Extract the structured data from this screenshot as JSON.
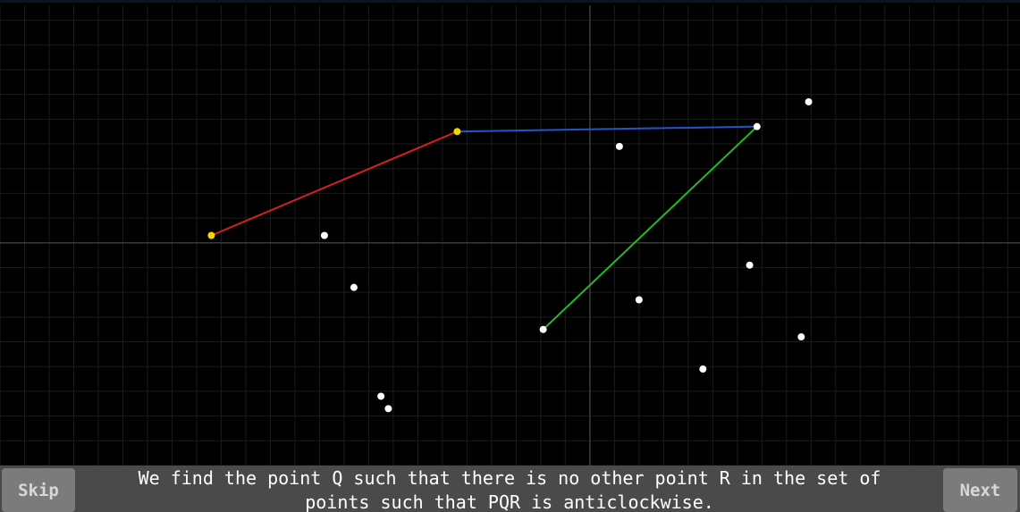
{
  "controls": {
    "skip_label": "Skip",
    "next_label": "Next"
  },
  "caption": {
    "text": "We find the point Q such that there is no other point R in the set of\npoints such that PQR is anticlockwise."
  },
  "colors": {
    "background": "#000000",
    "grid_minor": "#1c1c1c",
    "axis": "#3a3a3a",
    "point": "#ffffff",
    "hull_point": "#f2d600",
    "edge_hull": "#d42020",
    "edge_candidate": "#2255cc",
    "edge_test": "#22bb22",
    "bottom_bar": "#4a4a4a",
    "button": "#7b7b7b"
  },
  "scene": {
    "points": [
      {
        "x": -7.7,
        "y": 0.15,
        "hull": true
      },
      {
        "x": -2.7,
        "y": 2.25,
        "hull": true
      },
      {
        "x": 3.4,
        "y": 2.35,
        "hull": false
      },
      {
        "x": 4.45,
        "y": 2.85,
        "hull": false
      },
      {
        "x": 0.6,
        "y": 1.95,
        "hull": false
      },
      {
        "x": -5.4,
        "y": 0.15,
        "hull": false
      },
      {
        "x": -4.8,
        "y": -0.9,
        "hull": false
      },
      {
        "x": -0.95,
        "y": -1.75,
        "hull": false
      },
      {
        "x": 1.0,
        "y": -1.15,
        "hull": false
      },
      {
        "x": 3.25,
        "y": -0.45,
        "hull": false
      },
      {
        "x": 4.3,
        "y": -1.9,
        "hull": false
      },
      {
        "x": 2.3,
        "y": -2.55,
        "hull": false
      },
      {
        "x": -4.25,
        "y": -3.1,
        "hull": false
      },
      {
        "x": -4.1,
        "y": -3.35,
        "hull": false
      }
    ],
    "edges": [
      {
        "from": 0,
        "to": 1,
        "role": "hull"
      },
      {
        "from": 1,
        "to": 2,
        "role": "candidate"
      },
      {
        "from": 2,
        "to": 7,
        "role": "test"
      }
    ],
    "view": {
      "xmin": -12,
      "xmax": 8.75,
      "ymin": -4.5,
      "ymax": 4.8,
      "grid_step": 0.5
    }
  }
}
